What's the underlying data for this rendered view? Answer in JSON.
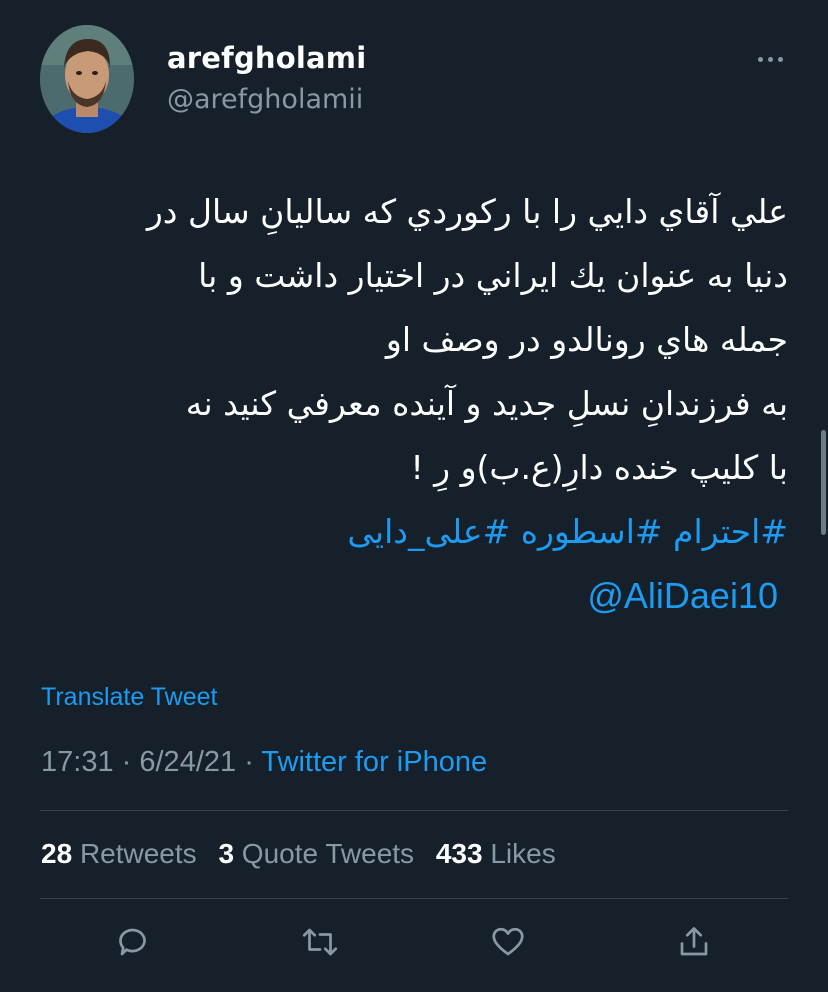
{
  "user": {
    "display_name": "arefgholami",
    "handle": "@arefgholamii"
  },
  "tweet": {
    "lines": [
      "علي آقاي دايي را با ركوردي كه ساليانِ سال  در",
      "دنيا به عنوان يك ايراني در اختيار داشت و با",
      "جمله هاي رونالدو در وصف او",
      "به فرزندانِ نسلِ جديد و آينده معرفي كنيد نه",
      "با كليپ خنده دارِ(ع.ب)و رِ !"
    ],
    "hashtags": "#احترام #اسطوره #علی_دایی",
    "mention": "@AliDaei10"
  },
  "translate_label": "Translate Tweet",
  "meta": {
    "time": "17:31",
    "separator": "·",
    "date": "6/24/21",
    "source": "Twitter for iPhone"
  },
  "stats": {
    "retweets": {
      "count": "28",
      "label": "Retweets"
    },
    "quote_tweets": {
      "count": "3",
      "label": "Quote Tweets"
    },
    "likes": {
      "count": "433",
      "label": "Likes"
    }
  },
  "actions": [
    "reply-icon",
    "retweet-icon",
    "like-icon",
    "share-icon"
  ],
  "colors": {
    "background": "#15202b",
    "accent": "#1d9bf0",
    "secondary_text": "#8899a6",
    "divider": "#38444d"
  }
}
